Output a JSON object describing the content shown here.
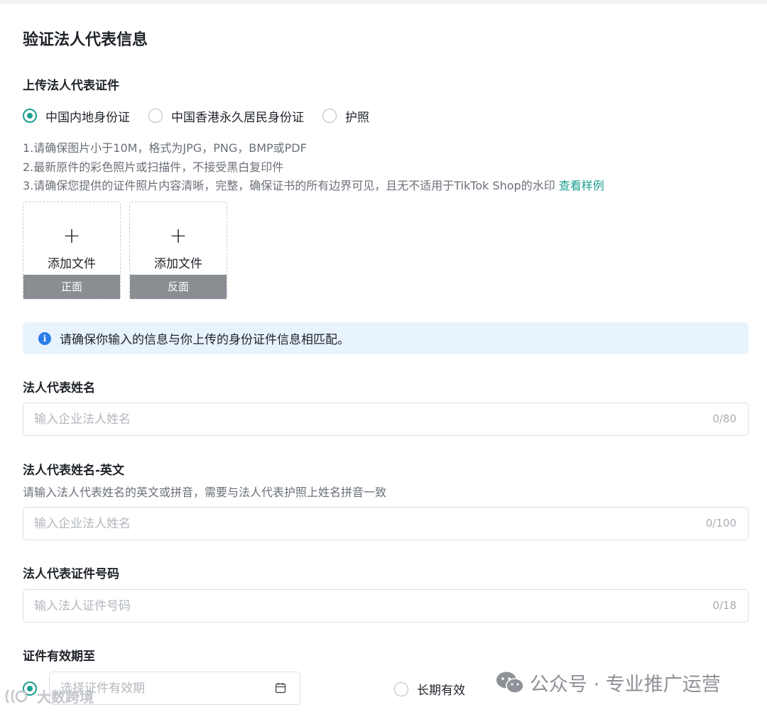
{
  "form": {
    "title": "验证法人代表信息",
    "upload_section_label": "上传法人代表证件",
    "id_types": [
      {
        "label": "中国内地身份证",
        "checked": true
      },
      {
        "label": "中国香港永久居民身份证",
        "checked": false
      },
      {
        "label": "护照",
        "checked": false
      }
    ],
    "hints": {
      "line1": "1.请确保图片小于10M，格式为JPG，PNG，BMP或PDF",
      "line2": "2.最新原件的彩色照片或扫描件，不接受黑白复印件",
      "line3": "3.请确保您提供的证件照片内容清晰，完整，确保证书的所有边界可见，且无不适用于TikTok Shop的水印",
      "link": "查看样例"
    },
    "uploads": [
      {
        "plus": "+",
        "text": "添加文件",
        "side": "正面"
      },
      {
        "plus": "+",
        "text": "添加文件",
        "side": "反面"
      }
    ],
    "info_banner": {
      "icon": "info-icon",
      "text": "请确保你输入的信息与你上传的身份证件信息相匹配。"
    },
    "fields": {
      "name": {
        "label": "法人代表姓名",
        "placeholder": "输入企业法人姓名",
        "counter": "0/80"
      },
      "name_en": {
        "label": "法人代表姓名-英文",
        "description": "请输入法人代表姓名的英文或拼音，需要与法人代表护照上姓名拼音一致",
        "placeholder": "输入企业法人姓名",
        "counter": "0/100"
      },
      "id_number": {
        "label": "法人代表证件号码",
        "placeholder": "输入法人证件号码",
        "counter": "0/18"
      },
      "expiry": {
        "label": "证件有效期至",
        "placeholder": "选择证件有效期",
        "longterm_label": "长期有效",
        "date_option_checked": true,
        "longterm_checked": false
      }
    }
  },
  "watermarks": {
    "brand": "公众号 · 专业推广运营",
    "left": "大数跨境"
  },
  "colors": {
    "accent": "#1a9f8f",
    "info_bg": "#e8f3fd",
    "info_icon": "#2b7de9",
    "muted_text": "#6b7079",
    "border": "#dcdfe3"
  }
}
